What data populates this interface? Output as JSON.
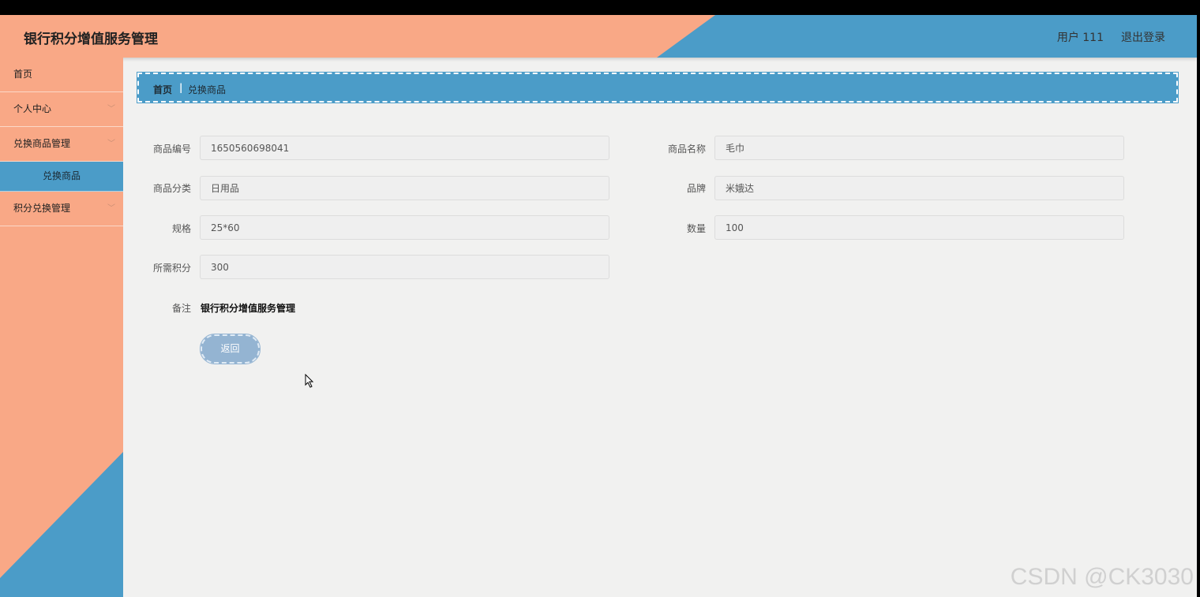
{
  "header": {
    "title": "银行积分增值服务管理",
    "user": "用户 111",
    "logout": "退出登录",
    "accent": "#f9a886",
    "blue": "#4b9cc8"
  },
  "sidebar": {
    "items": [
      {
        "label": "首页",
        "chevron": ""
      },
      {
        "label": "个人中心",
        "chevron": "﹀"
      },
      {
        "label": "兑换商品管理",
        "chevron": "﹀"
      },
      {
        "label": "兑换商品",
        "chevron": ""
      },
      {
        "label": "积分兑换管理",
        "chevron": "﹀"
      }
    ]
  },
  "breadcrumb": {
    "home": "首页",
    "sep": "|",
    "current": "兑换商品"
  },
  "form": {
    "code_label": "商品编号",
    "code_value": "1650560698041",
    "name_label": "商品名称",
    "name_value": "毛巾",
    "category_label": "商品分类",
    "category_value": "日用品",
    "brand_label": "品牌",
    "brand_value": "米娥达",
    "spec_label": "规格",
    "spec_value": "25*60",
    "qty_label": "数量",
    "qty_value": "100",
    "points_label": "所需积分",
    "points_value": "300",
    "note_label": "备注",
    "note_value": "银行积分增值服务管理",
    "back_label": "返回"
  },
  "watermark": "CSDN @CK3030"
}
